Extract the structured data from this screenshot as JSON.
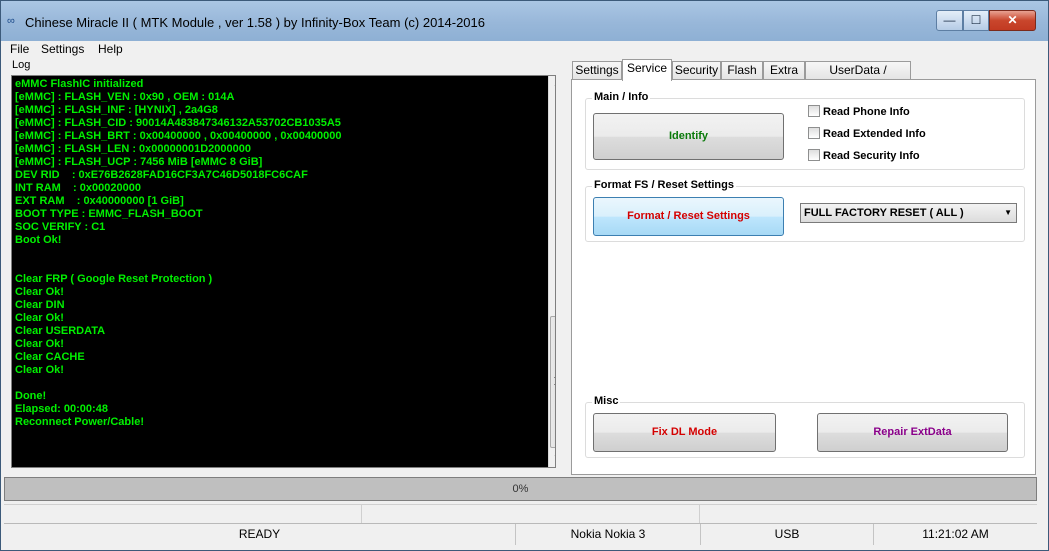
{
  "window": {
    "title": "Chinese Miracle II ( MTK Module , ver 1.58 ) by Infinity-Box Team (c) 2014-2016",
    "minimize_glyph": "—",
    "maximize_glyph": "☐",
    "close_glyph": "✕"
  },
  "menu": {
    "file": "File",
    "settings": "Settings",
    "help": "Help"
  },
  "log": {
    "label": "Log",
    "lines": [
      "eMMC FlashIC initialized",
      "[eMMC] : FLASH_VEN : 0x90 , OEM : 014A",
      "[eMMC] : FLASH_INF : [HYNIX] , 2a4G8",
      "[eMMC] : FLASH_CID : 90014A483847346132A53702CB1035A5",
      "[eMMC] : FLASH_BRT : 0x00400000 , 0x00400000 , 0x00400000",
      "[eMMC] : FLASH_LEN : 0x00000001D2000000",
      "[eMMC] : FLASH_UCP : 7456 MiB [eMMC 8 GiB]",
      "DEV RID    : 0xE76B2628FAD16CF3A7C46D5018FC6CAF",
      "INT RAM    : 0x00020000",
      "EXT RAM    : 0x40000000 [1 GiB]",
      "BOOT TYPE : EMMC_FLASH_BOOT",
      "SOC VERIFY : C1",
      "Boot Ok!",
      "",
      "",
      "Clear FRP ( Google Reset Protection )",
      "Clear Ok!",
      "Clear DIN",
      "Clear Ok!",
      "Clear USERDATA",
      "Clear Ok!",
      "Clear CACHE",
      "Clear Ok!",
      "",
      "Done!",
      "Elapsed: 00:00:48",
      "Reconnect Power/Cable!"
    ]
  },
  "tabs": [
    {
      "label": "Settings",
      "active": false
    },
    {
      "label": "Service",
      "active": true
    },
    {
      "label": "Security",
      "active": false
    },
    {
      "label": "Flash",
      "active": false
    },
    {
      "label": "Extra",
      "active": false
    },
    {
      "label": "UserData / Forensic",
      "active": false
    }
  ],
  "main_info": {
    "title": "Main / Info",
    "identify_label": "Identify",
    "checkboxes": [
      {
        "label": "Read Phone Info",
        "checked": false
      },
      {
        "label": "Read Extended Info",
        "checked": false
      },
      {
        "label": "Read Security Info",
        "checked": false
      }
    ]
  },
  "format": {
    "title": "Format FS / Reset Settings",
    "button_label": "Format / Reset Settings",
    "selected_option": "FULL FACTORY RESET ( ALL )"
  },
  "misc": {
    "title": "Misc",
    "fix_dl_label": "Fix DL Mode",
    "repair_label": "Repair ExtData"
  },
  "progress": {
    "text": "0%",
    "value": 0
  },
  "status": {
    "state": "READY",
    "device": "Nokia Nokia 3",
    "port": "USB",
    "time": "11:21:02 AM"
  },
  "colors": {
    "log_text": "#00f000",
    "identify": "#0a7a0a",
    "format_button": "#d40000",
    "fix_dl": "#d40000",
    "repair": "#8a008a"
  }
}
